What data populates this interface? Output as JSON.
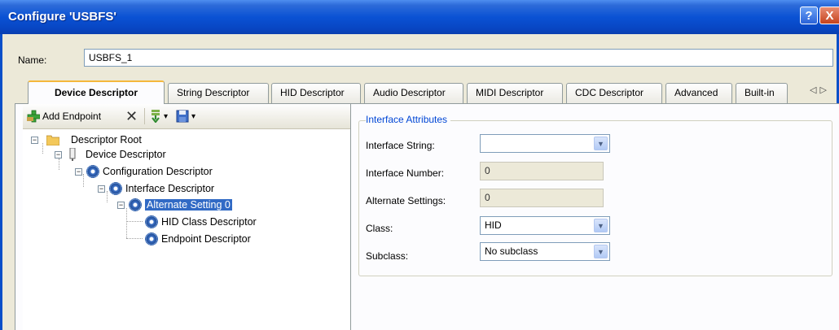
{
  "window": {
    "title": "Configure 'USBFS'",
    "help_glyph": "?",
    "close_glyph": "X"
  },
  "name_field": {
    "label": "Name:",
    "value": "USBFS_1"
  },
  "tabs": [
    {
      "label": "Device Descriptor",
      "active": true
    },
    {
      "label": "String Descriptor"
    },
    {
      "label": "HID Descriptor"
    },
    {
      "label": "Audio Descriptor"
    },
    {
      "label": "MIDI Descriptor"
    },
    {
      "label": "CDC Descriptor"
    },
    {
      "label": "Advanced"
    },
    {
      "label": "Built-in"
    }
  ],
  "tab_scroll": {
    "left": "◁",
    "right": "▷"
  },
  "toolbar": {
    "add_endpoint_label": "Add Endpoint",
    "delete_glyph": "✕",
    "dropdown_glyph": "▾"
  },
  "tree": {
    "root": "Descriptor Root",
    "device": "Device Descriptor",
    "configuration": "Configuration Descriptor",
    "interface": "Interface Descriptor",
    "alternate": "Alternate Setting 0",
    "hid_class": "HID Class Descriptor",
    "endpoint": "Endpoint Descriptor",
    "collapse_glyph": "−"
  },
  "attributes": {
    "group_title": "Interface Attributes",
    "interface_string": {
      "label": "Interface String:",
      "value": ""
    },
    "interface_number": {
      "label": "Interface Number:",
      "value": "0"
    },
    "alternate_settings": {
      "label": "Alternate Settings:",
      "value": "0"
    },
    "class": {
      "label": "Class:",
      "value": "HID"
    },
    "subclass": {
      "label": "Subclass:",
      "value": "No subclass"
    },
    "combo_arrow": "▼"
  },
  "colors": {
    "titlebar": "#0a52d4",
    "selection": "#316ac5",
    "group_title": "#0046d5",
    "active_tab_accent": "#f5b83c"
  }
}
